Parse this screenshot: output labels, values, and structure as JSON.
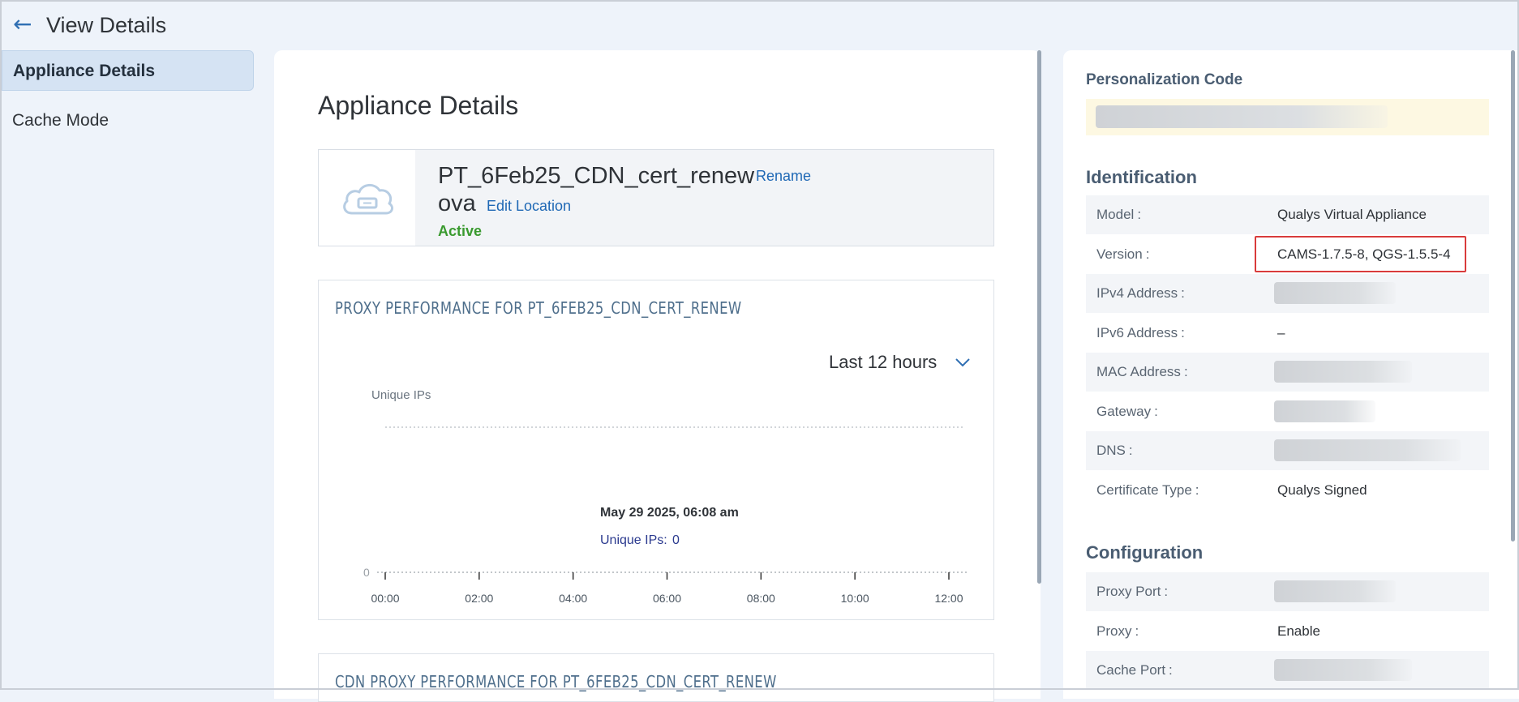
{
  "header": {
    "back_glyph": "←",
    "title": "View Details"
  },
  "nav": {
    "items": [
      {
        "label": "Appliance Details",
        "active": true
      },
      {
        "label": "Cache Mode",
        "active": false
      }
    ]
  },
  "main": {
    "section_title": "Appliance Details",
    "appliance": {
      "icon": "cloud-icon",
      "name_line1": "PT_6Feb25_CDN_cert_renew",
      "name_line2": "ova",
      "rename_label": "Rename",
      "edit_location_label": "Edit Location",
      "status": "Active",
      "status_color": "#3a9a2f"
    },
    "proxy_perf": {
      "title": "PROXY PERFORMANCE FOR PT_6FEB25_CDN_CERT_RENEW",
      "range_label": "Last 12 hours",
      "tooltip": {
        "timestamp": "May 29 2025, 06:08 am",
        "series_label": "Unique IPs:",
        "value": "0"
      }
    },
    "cdn_perf": {
      "title": "CDN PROXY PERFORMANCE FOR PT_6FEB25_CDN_CERT_RENEW"
    }
  },
  "chart_data": {
    "type": "line",
    "ylabel": "Unique IPs",
    "yticks": [
      "0"
    ],
    "categories": [
      "00:00",
      "02:00",
      "04:00",
      "06:00",
      "08:00",
      "10:00",
      "12:00"
    ],
    "series": [
      {
        "name": "Unique IPs",
        "values": [
          0,
          0,
          0,
          0,
          0,
          0,
          0
        ]
      }
    ],
    "ylim": [
      0,
      1
    ],
    "grid": true,
    "line_color": "#2b3a8f"
  },
  "right": {
    "personalization_label": "Personalization Code",
    "identification_heading": "Identification",
    "identification": [
      {
        "label": "Model",
        "value": "Qualys Virtual Appliance",
        "blurred": false
      },
      {
        "label": "Version",
        "value": "CAMS-1.7.5-8, QGS-1.5.5-4",
        "blurred": false,
        "highlighted": true
      },
      {
        "label": "IPv4 Address",
        "value": "",
        "blurred": true
      },
      {
        "label": "IPv6 Address",
        "value": "–",
        "blurred": false
      },
      {
        "label": "MAC Address",
        "value": "",
        "blurred": true
      },
      {
        "label": "Gateway",
        "value": "",
        "blurred": true
      },
      {
        "label": "DNS",
        "value": "",
        "blurred": true
      },
      {
        "label": "Certificate Type",
        "value": "Qualys Signed",
        "blurred": false
      }
    ],
    "configuration_heading": "Configuration",
    "configuration": [
      {
        "label": "Proxy Port",
        "value": "",
        "blurred": true
      },
      {
        "label": "Proxy",
        "value": "Enable",
        "blurred": false
      },
      {
        "label": "Cache Port",
        "value": "",
        "blurred": true
      }
    ],
    "colon": ":"
  }
}
